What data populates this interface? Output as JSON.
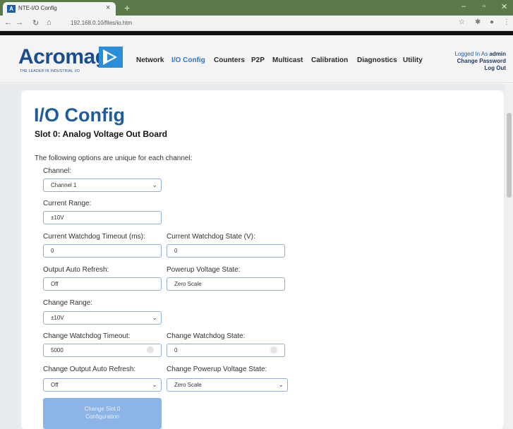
{
  "browser": {
    "tab_title": "NTE-I/O Config",
    "url": "192.168.0.10/files/io.htm",
    "new_tab": "+",
    "tab_close": "×",
    "favicon": "A"
  },
  "header": {
    "logo": "Acromag",
    "tagline": "THE LEADER IN INDUSTRIAL I/O",
    "nav": [
      {
        "label": "Network"
      },
      {
        "label": "I/O Config"
      },
      {
        "label": "Counters"
      },
      {
        "label": "P2P"
      },
      {
        "label": "Multicast"
      },
      {
        "label": "Calibration"
      },
      {
        "label": "Diagnostics"
      },
      {
        "label": "Utility"
      }
    ],
    "active_nav": "I/O Config",
    "logged_in_prefix": "Logged In As",
    "user": "admin",
    "change_password": "Change Password",
    "logout": "Log Out"
  },
  "main": {
    "title": "I/O Config",
    "slot_title": "Slot 0: Analog Voltage Out Board",
    "intro": "The following options are unique for each channel:",
    "channel": {
      "label": "Channel:",
      "value": "Channel 1"
    },
    "current_range": {
      "label": "Current Range:",
      "value": "±10V"
    },
    "current_wd_timeout": {
      "label": "Current Watchdog Timeout (ms):",
      "value": "0"
    },
    "current_wd_state": {
      "label": "Current Watchdog State (V):",
      "value": "0"
    },
    "output_auto_refresh": {
      "label": "Output Auto Refresh:",
      "value": "Off"
    },
    "powerup_voltage_state": {
      "label": "Powerup Voltage State:",
      "value": "Zero Scale"
    },
    "change_range": {
      "label": "Change Range:",
      "value": "±10V"
    },
    "change_wd_timeout": {
      "label": "Change Watchdog Timeout:",
      "value": "5000"
    },
    "change_wd_state": {
      "label": "Change Watchdog State:",
      "value": "0"
    },
    "change_output_auto_refresh": {
      "label": "Change Output Auto Refresh:",
      "value": "Off"
    },
    "change_powerup_voltage_state": {
      "label": "Change Powerup Voltage State:",
      "value": "Zero Scale"
    },
    "submit_line1": "Change Slot 0",
    "submit_line2": "Configuration"
  },
  "colors": {
    "brand": "#1a4d8f",
    "accent": "#2b7bd4",
    "button": "#8cb4e6"
  }
}
